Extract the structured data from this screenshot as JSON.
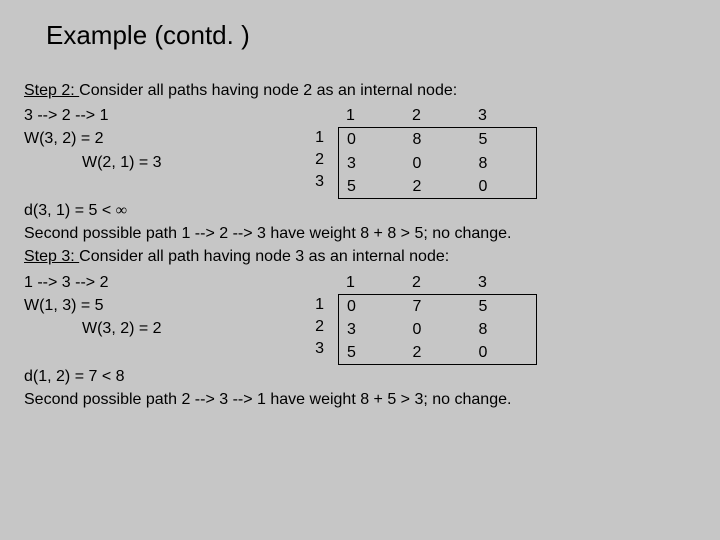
{
  "title": "Example (contd. )",
  "step2": {
    "label": "Step 2: ",
    "desc": "Consider all paths having node 2 as an internal node:",
    "path": "3   -->   2   -->   1",
    "w1": "W(3, 2) = 2",
    "w2": "W(2, 1) = 3",
    "header": [
      "1",
      "2",
      "3"
    ],
    "rows": [
      {
        "idx": "1",
        "cells": [
          "0",
          "8",
          "5"
        ]
      },
      {
        "idx": "2",
        "cells": [
          "3",
          "0",
          "8"
        ]
      },
      {
        "idx": "3",
        "cells": [
          "5",
          "2",
          "0"
        ]
      }
    ],
    "result_a": "d(3, 1) = 5 < ",
    "result_inf": "∞",
    "second": "Second possible path 1 --> 2 --> 3  have weight 8 + 8 > 5; no change."
  },
  "step3": {
    "label": "Step 3: ",
    "desc": "Consider all path having node 3 as an internal node:",
    "path": "1   -->   3   -->   2",
    "w1": "W(1, 3) = 5",
    "w2": "W(3, 2) = 2",
    "header": [
      "1",
      "2",
      "3"
    ],
    "rows": [
      {
        "idx": "1",
        "cells": [
          "0",
          "7",
          "5"
        ]
      },
      {
        "idx": "2",
        "cells": [
          "3",
          "0",
          "8"
        ]
      },
      {
        "idx": "3",
        "cells": [
          "5",
          "2",
          "0"
        ]
      }
    ],
    "result": "d(1, 2) = 7 < 8",
    "second": "Second possible path 2 --> 3 --> 1  have weight 8 + 5 > 3; no change."
  }
}
